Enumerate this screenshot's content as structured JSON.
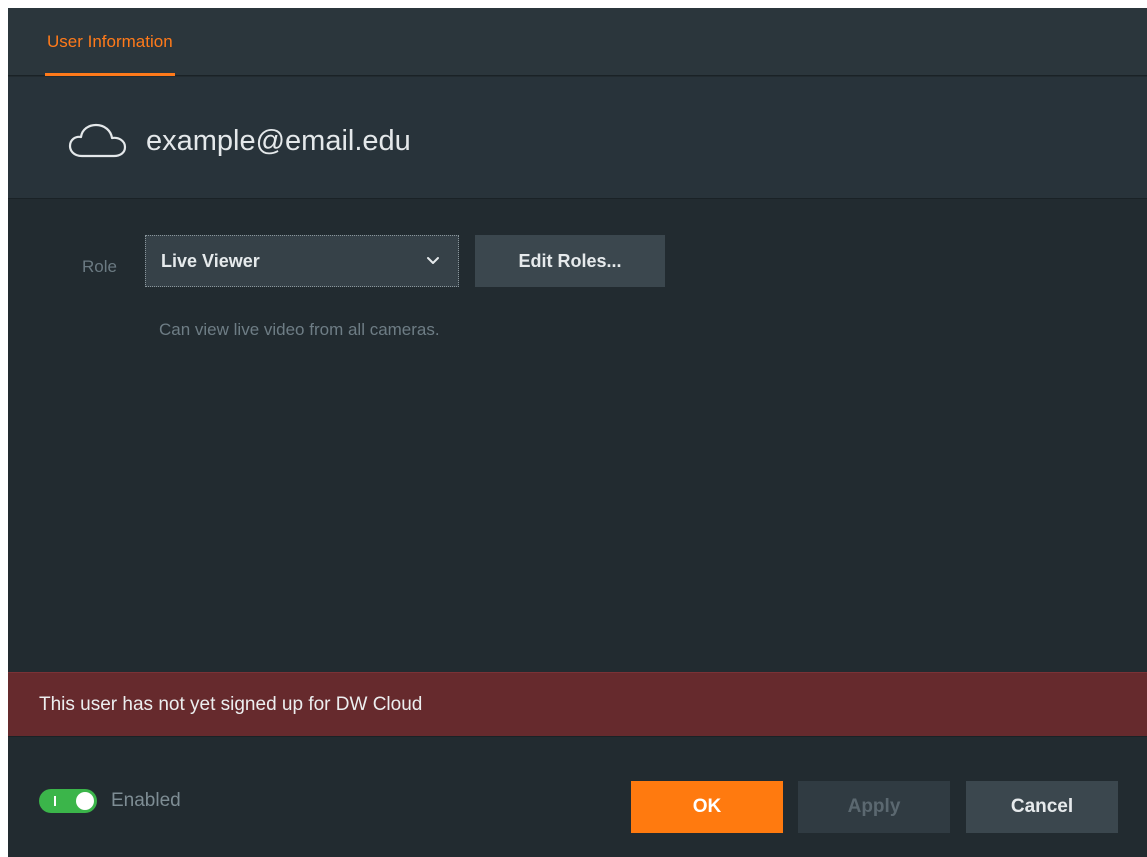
{
  "tabs": [
    {
      "label": "User Information",
      "active": true
    }
  ],
  "user": {
    "email": "example@email.edu",
    "icon": "cloud-icon"
  },
  "role": {
    "label": "Role",
    "selected": "Live Viewer",
    "edit_button": "Edit Roles...",
    "description": "Can view live video from all cameras."
  },
  "warning": {
    "text": "This user has not yet signed up for DW Cloud",
    "color": "#662a2d"
  },
  "footer": {
    "enabled_label": "Enabled",
    "enabled": true,
    "ok": "OK",
    "apply": "Apply",
    "cancel": "Cancel"
  },
  "colors": {
    "accent": "#ff7a1a",
    "toggle_on": "#3bb54a",
    "background": "#222b30"
  }
}
